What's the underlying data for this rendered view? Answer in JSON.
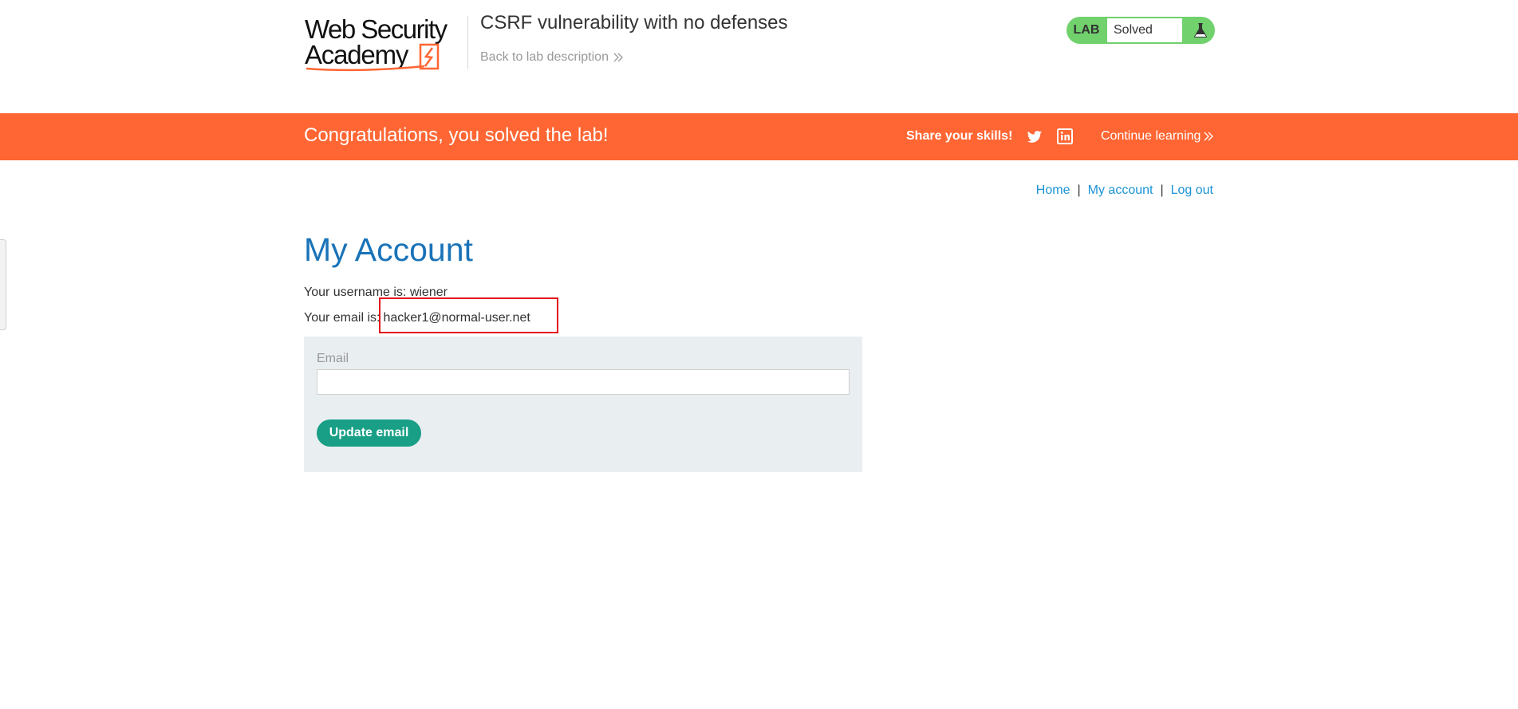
{
  "header": {
    "logo_line1": "Web Security",
    "logo_line2": "Academy",
    "lab_title": "CSRF vulnerability with no defenses",
    "back_link": "Back to lab description",
    "lab_tag": "LAB",
    "lab_status": "Solved",
    "lab_icon": "flask-icon"
  },
  "banner": {
    "message": "Congratulations, you solved the lab!",
    "share_label": "Share your skills!",
    "share_icons": [
      "twitter-icon",
      "linkedin-icon"
    ],
    "continue_link": "Continue learning",
    "background_color": "#ff6633"
  },
  "nav": {
    "home": "Home",
    "separator": "|",
    "my_account": "My account",
    "log_out": "Log out"
  },
  "main": {
    "title": "My Account",
    "username_prefix": "Your username is: ",
    "username": "wiener",
    "email_prefix": "Your email is:",
    "email": "hacker1@normal-user.net"
  },
  "form": {
    "email_label": "Email",
    "email_value": "",
    "submit_label": "Update email"
  },
  "colors": {
    "accent_blue": "#1a73b8",
    "link_blue": "#1a93d4",
    "button_green": "#189f86",
    "solved_green": "#70d16d",
    "highlight_red": "#e3101d"
  }
}
